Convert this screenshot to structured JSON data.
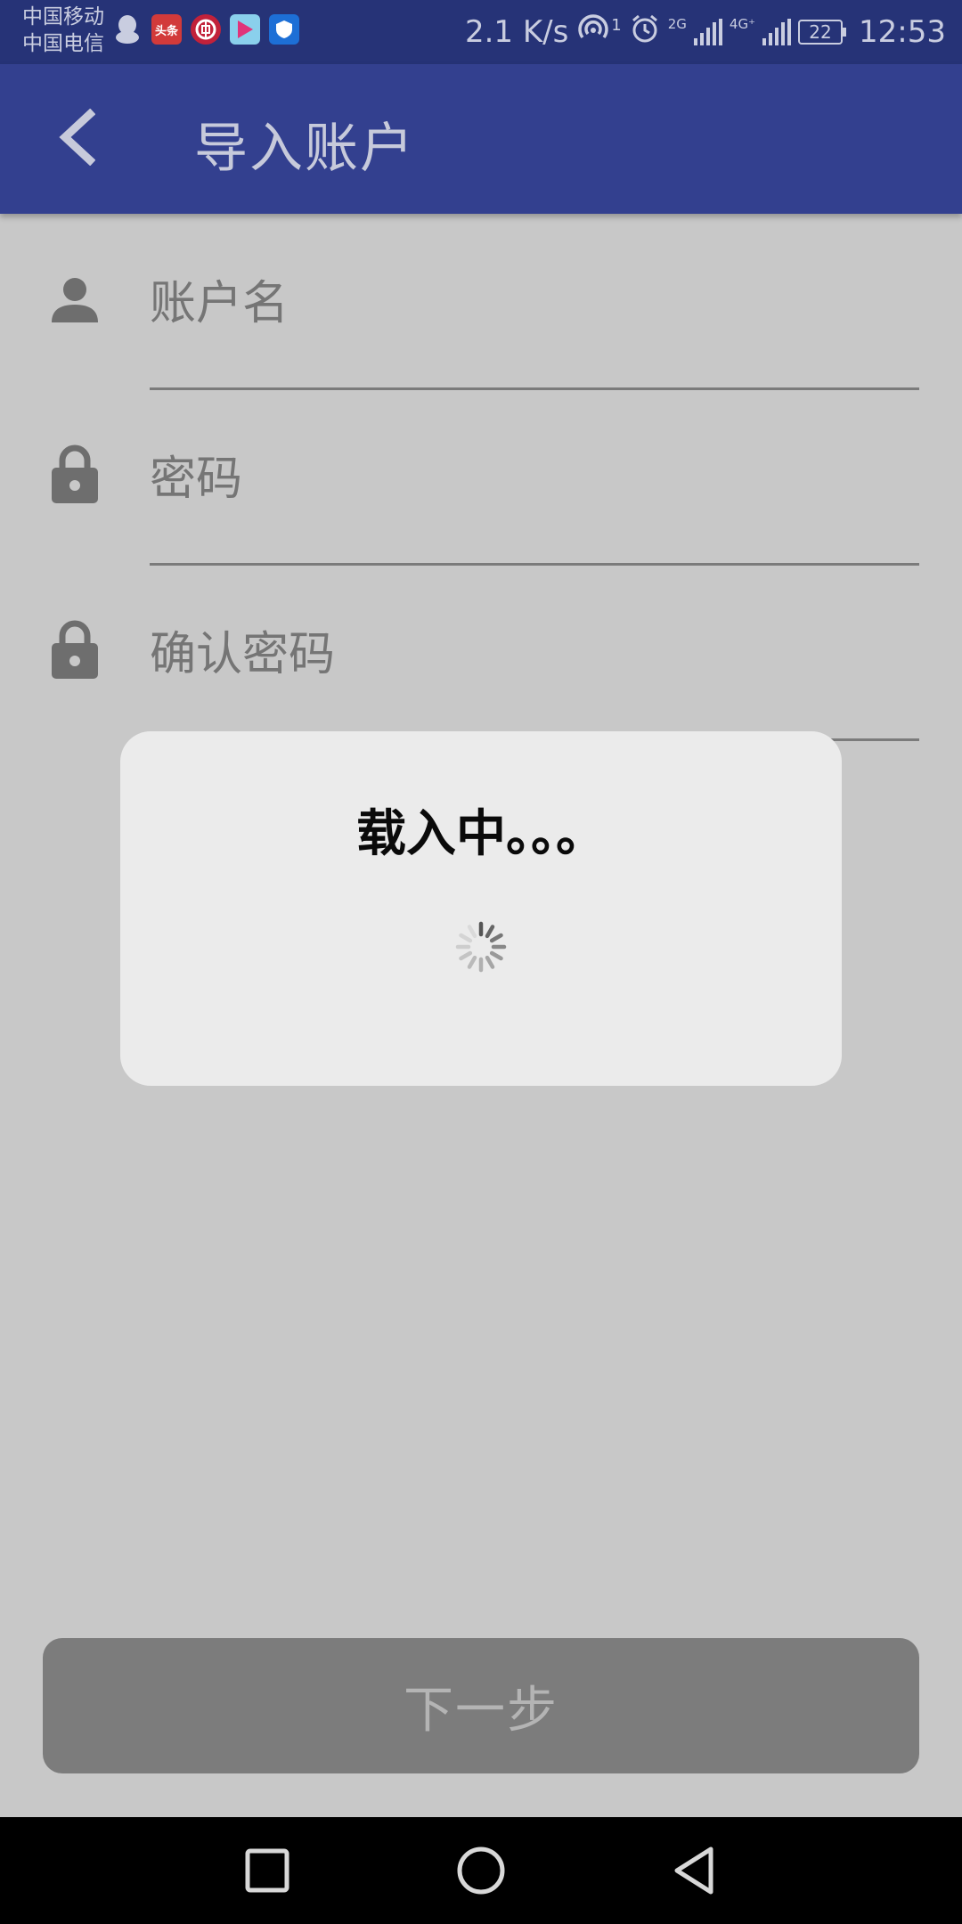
{
  "status_bar": {
    "carrier_1": "中国移动",
    "carrier_2": "中国电信",
    "net_speed": "2.1 K/s",
    "hotspot_count": "1",
    "signal_1_label": "2G",
    "signal_2_label": "4G⁺",
    "battery_level": "22",
    "time": "12:53",
    "app_icons": [
      "qq-icon",
      "toutiao-icon",
      "bank-icon",
      "video-app-icon",
      "shield-app-icon"
    ],
    "app_icon_texts": {
      "toutiao": "头条"
    }
  },
  "app_bar": {
    "title": "导入账户",
    "back_icon": "chevron-left-icon"
  },
  "form": {
    "account_placeholder": "账户名",
    "password_placeholder": "密码",
    "confirm_password_placeholder": "确认密码"
  },
  "dialog": {
    "message": "载入中。。。"
  },
  "next_button": {
    "label": "下一步"
  },
  "colors": {
    "status_bar_bg": "#263377",
    "app_bar_bg": "#33408f",
    "page_bg": "#c8c8c8",
    "dialog_bg": "#ebebeb",
    "button_bg": "#7c7c7c"
  }
}
